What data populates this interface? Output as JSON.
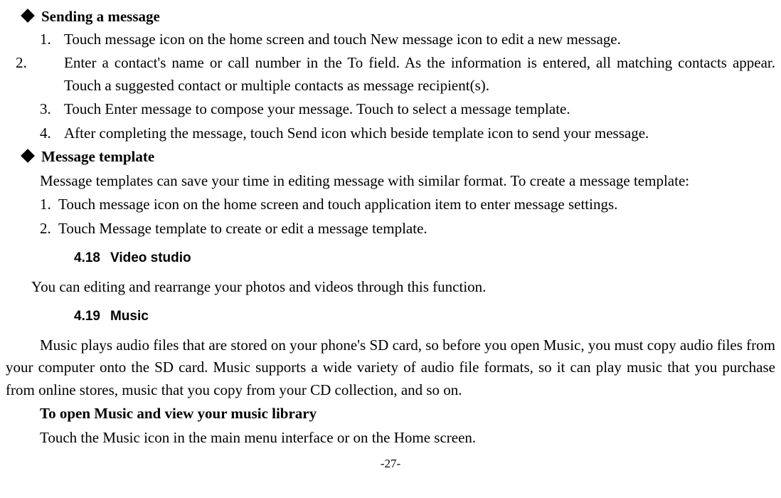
{
  "sections": {
    "sending": {
      "title": "Sending a message",
      "items": [
        "Touch message icon on the home screen and touch New message icon to edit a new message.",
        "Enter a contact's name or call number in the To field. As the information is entered, all matching contacts appear. Touch a suggested contact or multiple contacts as message recipient(s).",
        "Touch Enter message to compose your message. Touch to select a message template.",
        "After completing the message, touch Send icon which beside template icon to send your message."
      ]
    },
    "template": {
      "title": "Message template",
      "intro": "Message templates can save your time in editing message with similar format. To create a message template:",
      "items": [
        "Touch message icon on the home screen and touch application item to enter message settings.",
        "Touch Message template to create or edit a message template."
      ]
    },
    "video": {
      "num": "4.18",
      "title": "Video studio",
      "body": "You can editing and rearrange your photos and videos through this function."
    },
    "music": {
      "num": "4.19",
      "title": "Music",
      "body": "Music plays audio files that are stored on your phone's SD card, so before you open Music, you must copy audio files from your computer onto the SD card. Music supports a wide variety of audio file formats, so it can play music that you purchase from online stores, music that you copy from your CD collection, and so on.",
      "sub_title": "To open Music and view your music library",
      "sub_body": "Touch the Music icon in the main menu interface or on the Home screen."
    }
  },
  "page_number": "-27-"
}
